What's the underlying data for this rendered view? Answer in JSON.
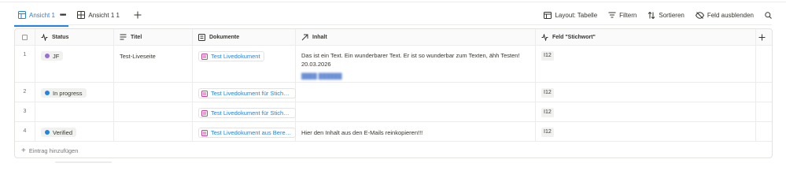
{
  "views": [
    {
      "label": "Ansicht 1",
      "active": true,
      "icon": "table-view-icon"
    },
    {
      "label": "Ansicht 1 1",
      "active": false,
      "icon": "grid-view-icon"
    }
  ],
  "toolbar": {
    "layout_label": "Layout: Tabelle",
    "filter_label": "Filtern",
    "sort_label": "Sortieren",
    "hide_field_label": "Feld ausblenden"
  },
  "columns": {
    "status": "Status",
    "titel": "Titel",
    "dokumente": "Dokumente",
    "inhalt": "Inhalt",
    "stichwort": "Feld \"Stichwort\""
  },
  "rows": [
    {
      "num": "1",
      "status": {
        "label": "JF",
        "color": "#9a6dd7"
      },
      "titel": "Test-Liveseite",
      "dokument": "Test Livedokument",
      "inhalt": "Das ist ein Text. Ein wunderbarer Text. Er ist so wunderbar zum Texten, ähh Testen! 20.03.2026",
      "stichwort": "I12"
    },
    {
      "num": "2",
      "status": {
        "label": "In progress",
        "color": "#2383e2"
      },
      "titel": "",
      "dokument": "Test Livedokument für Stichwö...",
      "inhalt": "",
      "stichwort": "I12"
    },
    {
      "num": "3",
      "status": null,
      "titel": "",
      "dokument": "Test Livedokument für Stichwo...",
      "inhalt": "",
      "stichwort": "I12"
    },
    {
      "num": "4",
      "status": {
        "label": "Verified",
        "color": "#2383e2"
      },
      "titel": "",
      "dokument": "Test Livedokument aus Bereic...",
      "inhalt": "Hier den Inhalt aus den E-Mails reinkopieren!!!",
      "stichwort": "I12"
    }
  ],
  "add_entry_label": "Eintrag hinzufügen",
  "colors": {
    "accent": "#2383e2",
    "doc_icon": "#d23f9b"
  }
}
